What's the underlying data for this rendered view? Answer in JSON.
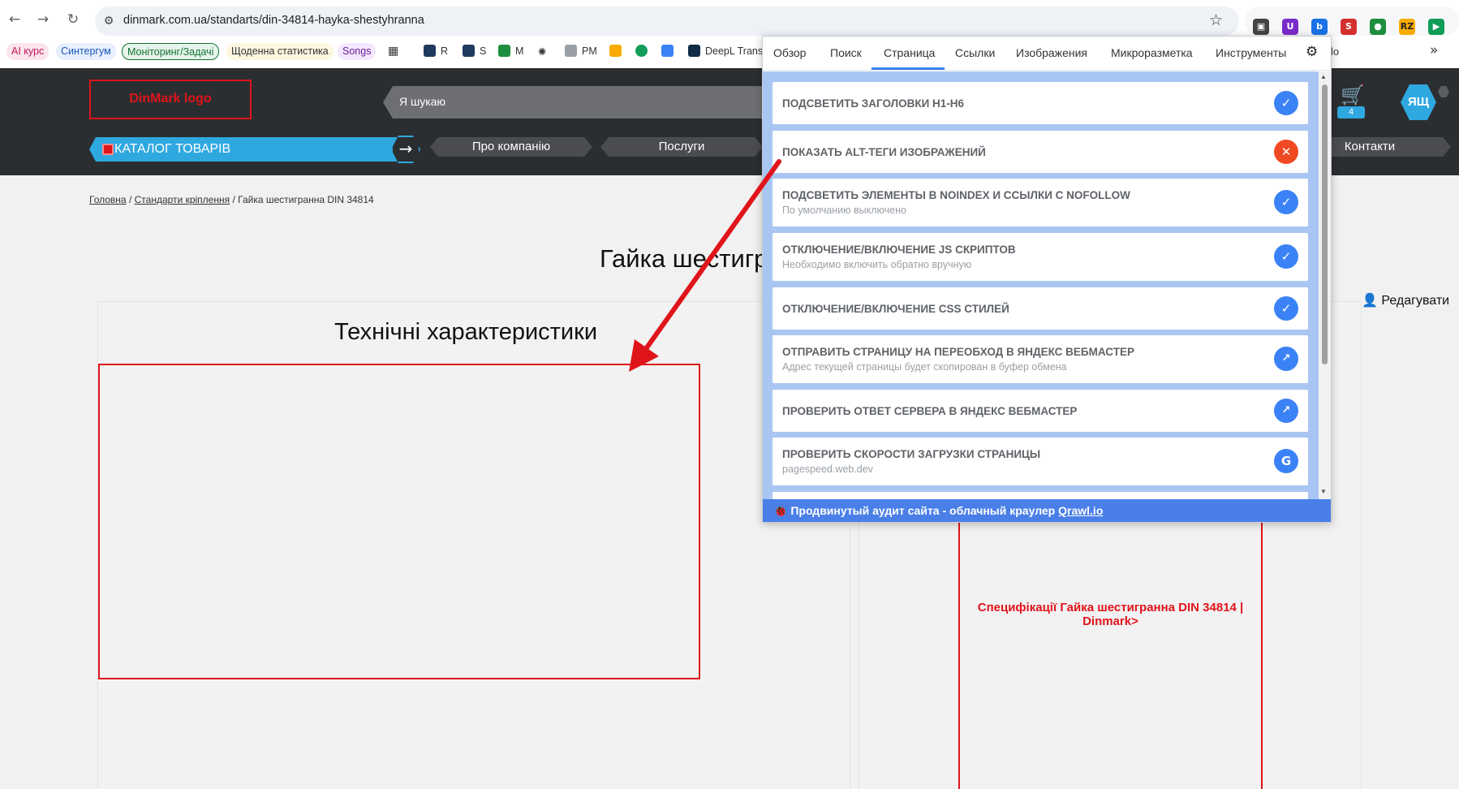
{
  "browser": {
    "url": "dinmark.com.ua/standarts/din-34814-hayka-shestyhranna",
    "bookmarks": [
      {
        "label": "AI курс",
        "color": "#fce4ec",
        "text": "#c2185b"
      },
      {
        "label": "Синтергум",
        "color": "#e8f0fe",
        "text": "#1a56b8"
      },
      {
        "label": "Моніторинг/Задачі",
        "color": "#e6f4ea",
        "text": "#137333"
      },
      {
        "label": "Щоденна статистика",
        "color": "#fef7e0",
        "text": "#333333"
      },
      {
        "label": "Songs",
        "color": "#f3e8fd",
        "text": "#6a1b9a"
      }
    ],
    "bookmark_plain": [
      "R",
      "S",
      "M",
      "PM",
      "DeepL Transla"
    ]
  },
  "site": {
    "logo_text": "DinMark logo",
    "search_placeholder": "Я шукаю",
    "catalog_label": "КАТАЛОГ ТОВАРІВ",
    "menu": [
      "Про компанію",
      "Послуги",
      "Контакти"
    ],
    "cart_count": "4",
    "avatar_initials": "ЯЩ",
    "breadcrumb": [
      "Головна",
      "Стандарти кріплення",
      "Гайка шестигранна DIN 34814"
    ],
    "breadcrumb_sep": "/",
    "page_title": "Гайка шестигр",
    "edit_label": "Редагувати",
    "specs_title": "Технічні характеристики",
    "image_alt": "Специфікації Гайка шестигранна DIN 34814 | Dinmark>"
  },
  "popup": {
    "tabs": [
      "Обзор",
      "Поиск",
      "Страница",
      "Ссылки",
      "Изображения",
      "Микроразметка",
      "Инструменты"
    ],
    "active_tab": "Страница",
    "leftover_text": "lo",
    "cards": [
      {
        "title": "ПОДСВЕТИТЬ ЗАГОЛОВКИ H1-H6",
        "subtitle": "",
        "state": "check"
      },
      {
        "title": "ПОКАЗАТЬ ALT-ТЕГИ ИЗОБРАЖЕНИЙ",
        "subtitle": "",
        "state": "close"
      },
      {
        "title": "ПОДСВЕТИТЬ ЭЛЕМЕНТЫ В NOINDEX И ССЫЛКИ С NOFOLLOW",
        "subtitle": "По умолчанию выключено",
        "state": "check"
      },
      {
        "title": "ОТКЛЮЧЕНИЕ/ВКЛЮЧЕНИЕ JS СКРИПТОВ",
        "subtitle": "Необходимо включить обратно вручную",
        "state": "check"
      },
      {
        "title": "ОТКЛЮЧЕНИЕ/ВКЛЮЧЕНИЕ CSS СТИЛЕЙ",
        "subtitle": "",
        "state": "check"
      },
      {
        "title": "ОТПРАВИТЬ СТРАНИЦУ НА ПЕРЕОБХОД В ЯНДЕКС ВЕБМАСТЕР",
        "subtitle": "Адрес текущей страницы будет скопирован в буфер обмена",
        "state": "external"
      },
      {
        "title": "ПРОВЕРИТЬ ОТВЕТ СЕРВЕРА В ЯНДЕКС ВЕБМАСТЕР",
        "subtitle": "",
        "state": "external"
      },
      {
        "title": "ПРОВЕРИТЬ СКОРОСТИ ЗАГРУЗКИ СТРАНИЦЫ",
        "subtitle": "pagespeed.web.dev",
        "state": "google"
      }
    ],
    "footer_text": "Продвинутый аудит сайта - облачный краулер ",
    "footer_link": "Qrawl.io"
  },
  "colors": {
    "accent": "#3b82f6",
    "danger": "#f04a23",
    "annotation": "#e0141b",
    "site_blue": "#2fa8e0"
  }
}
